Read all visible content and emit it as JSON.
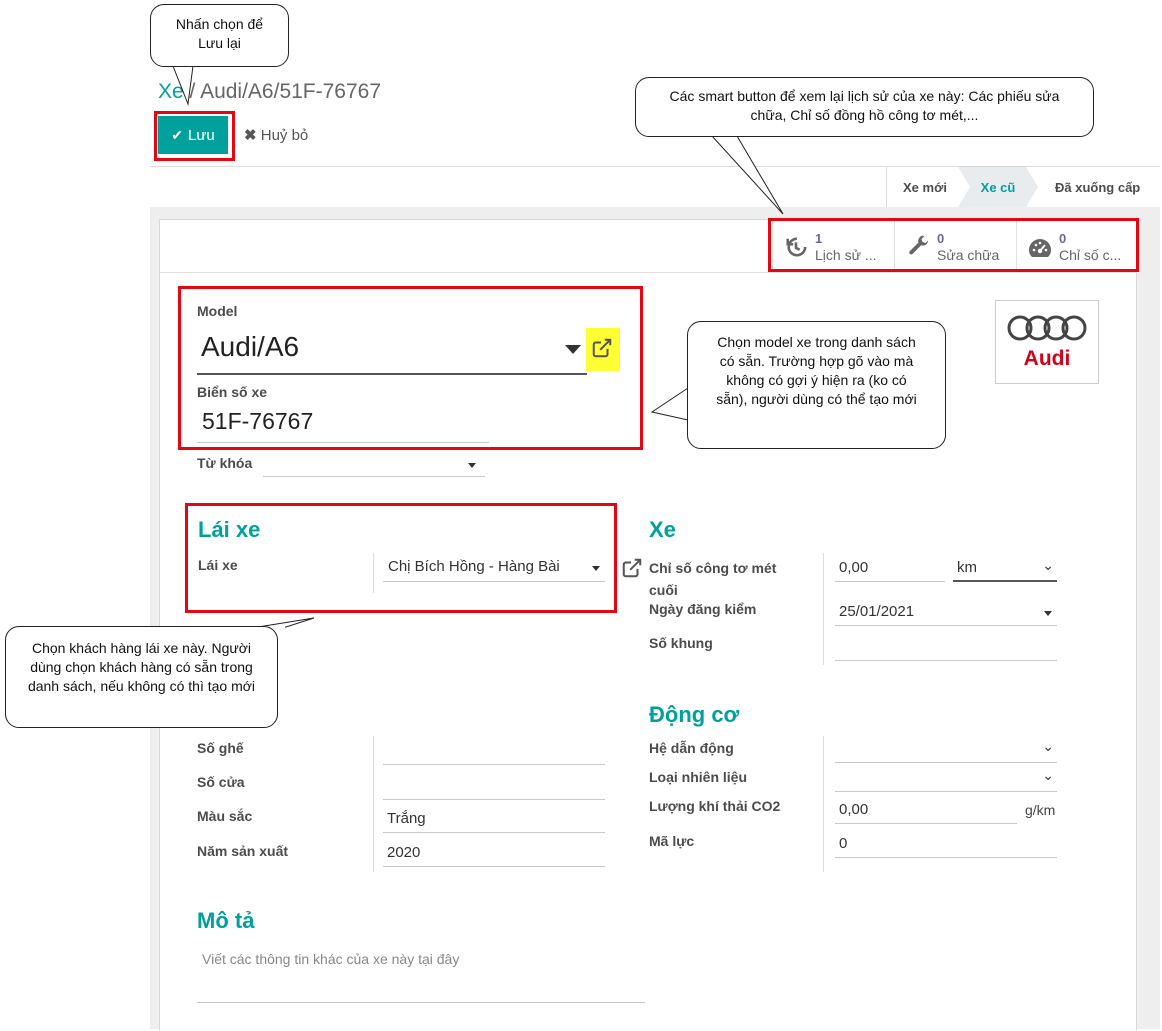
{
  "breadcrumb": {
    "parent": "Xe",
    "separator": "/",
    "current": "Audi/A6/51F-76767"
  },
  "toolbar": {
    "save_label": "Lưu",
    "discard_label": "Huỷ bỏ"
  },
  "stages": [
    "Xe mới",
    "Xe cũ",
    "Đã xuống cấp"
  ],
  "active_stage": "Xe cũ",
  "smart_buttons": [
    {
      "count": "1",
      "label": "Lịch sử ...",
      "icon": "history-icon"
    },
    {
      "count": "0",
      "label": "Sửa chữa",
      "icon": "wrench-icon"
    },
    {
      "count": "0",
      "label": "Chỉ số c...",
      "icon": "tachometer-icon"
    }
  ],
  "form": {
    "model_label": "Model",
    "model_value": "Audi/A6",
    "plate_label": "Biển số xe",
    "plate_value": "51F-76767",
    "tags_label": "Từ khóa",
    "tags_value": "",
    "logo_brand": "Audi"
  },
  "driver_section": {
    "title": "Lái xe",
    "driver_label": "Lái xe",
    "driver_value": "Chị Bích Hồng - Hàng Bài"
  },
  "car_section": {
    "title": "Xe",
    "odometer_label": "Chỉ số công tơ mét cuối",
    "odometer_value": "0,00",
    "odometer_unit": "km",
    "inspection_label": "Ngày đăng kiểm",
    "inspection_value": "25/01/2021",
    "chassis_label": "Số khung",
    "chassis_value": ""
  },
  "misc_fields": [
    {
      "label": "Số ghế",
      "value": ""
    },
    {
      "label": "Số cửa",
      "value": ""
    },
    {
      "label": "Màu sắc",
      "value": "Trắng"
    },
    {
      "label": "Năm sản xuất",
      "value": "2020"
    }
  ],
  "engine_section": {
    "title": "Động cơ",
    "transmission_label": "Hệ dẫn động",
    "transmission_value": "",
    "fuel_label": "Loại nhiên liệu",
    "fuel_value": "",
    "co2_label": "Lượng khí thải CO2",
    "co2_value": "0,00",
    "co2_unit": "g/km",
    "power_label": "Mã lực",
    "power_value": "0"
  },
  "description": {
    "title": "Mô tả",
    "placeholder": "Viết các thông tin khác của xe này tại đây"
  },
  "callouts": {
    "save": "Nhấn chọn để Lưu lại",
    "smart": "Các smart button để xem lại lịch sử của xe này: Các phiếu sửa chữa, Chỉ số đồng hồ công tơ mét,...",
    "model": "Chọn model xe trong danh sách có sẵn. Trường hợp gõ vào mà không có gợi ý hiện ra (ko có sẵn), người dùng có thể tạo mới",
    "driver": "Chọn khách hàng lái xe này. Người dùng chọn khách hàng có sẵn trong danh sách, nếu không có thì tạo mới"
  },
  "colors": {
    "accent": "#00a09d",
    "annotation_red": "#e30613",
    "highlight_yellow": "#ffff33"
  }
}
